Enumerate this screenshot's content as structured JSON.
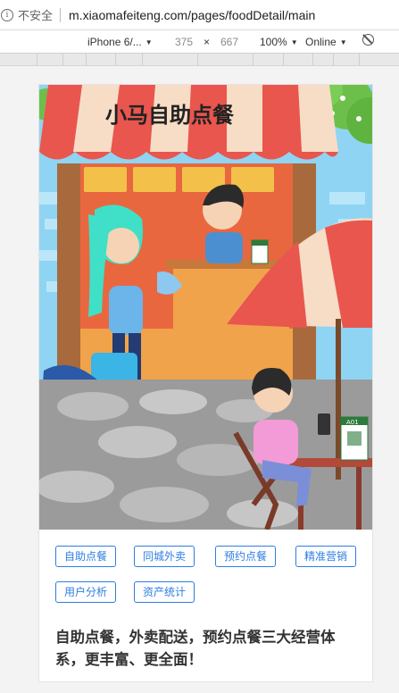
{
  "browser": {
    "security_label": "不安全",
    "url": "m.xiaomafeiteng.com/pages/foodDetail/main"
  },
  "device_toolbar": {
    "device": "iPhone 6/...",
    "width": "375",
    "times": "×",
    "height": "667",
    "zoom": "100%",
    "network": "Online"
  },
  "hero": {
    "logo_text": "小马自助点餐",
    "badge": "A01"
  },
  "tags": [
    "自助点餐",
    "同城外卖",
    "预约点餐",
    "精准营销",
    "用户分析",
    "资产统计"
  ],
  "description": "自助点餐，外卖配送，预约点餐三大经营体系，更丰富、更全面！",
  "colors": {
    "tag_blue": "#2f7de1",
    "awning_red": "#e8564e",
    "wall_orange": "#e9673f",
    "sky_blue": "#8fd4f2"
  }
}
